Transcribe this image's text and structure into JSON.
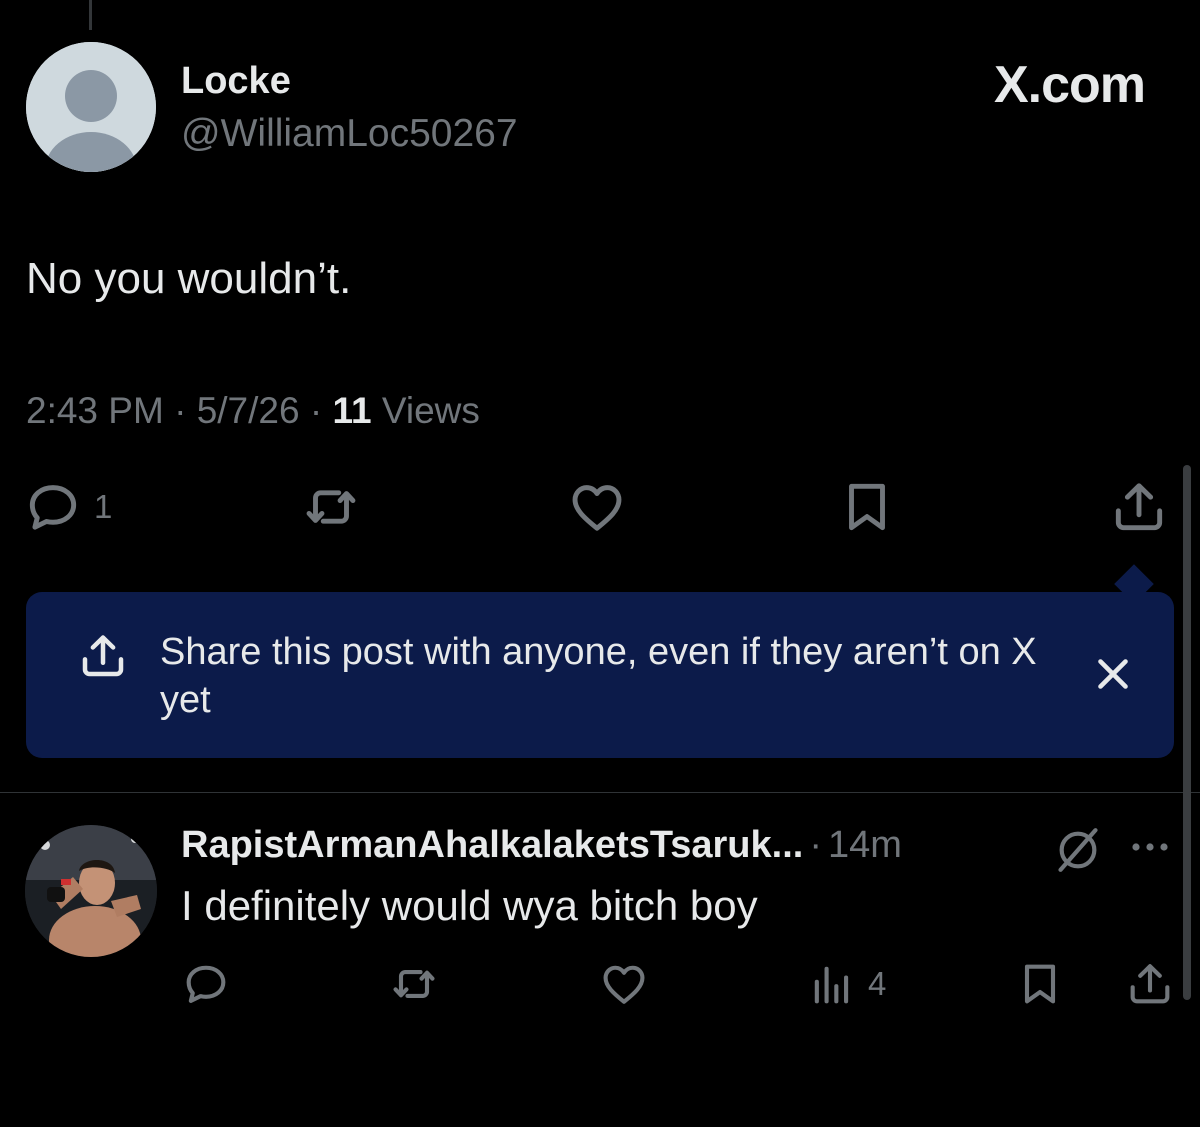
{
  "post": {
    "author_name": "Locke",
    "author_handle": "@WilliamLoc50267",
    "brand": "X.com",
    "text": "No you wouldn’t.",
    "time": "2:43 PM",
    "date": "5/7/26",
    "views_count": "11",
    "views_label": "Views",
    "reply_count": "1"
  },
  "tooltip": {
    "text": "Share this post with anyone, even if they aren’t on X yet"
  },
  "reply": {
    "name": "RapistArmanAhalkalaketsTsaruk...",
    "time": "14m",
    "text": "I definitely would wya bitch boy",
    "views_count": "4"
  },
  "icons": {
    "reply": "comment-bubble-icon",
    "repost": "repost-icon",
    "like": "heart-icon",
    "bookmark": "bookmark-icon",
    "share": "share-icon",
    "views": "bar-chart-icon",
    "grok": "grok-icon",
    "more": "more-dots-icon",
    "close": "close-icon"
  },
  "colors": {
    "background": "#000000",
    "text_primary": "#e7e9ea",
    "text_secondary": "#71767b",
    "tooltip_bg": "#0c1b4a",
    "divider": "#2f3336"
  }
}
